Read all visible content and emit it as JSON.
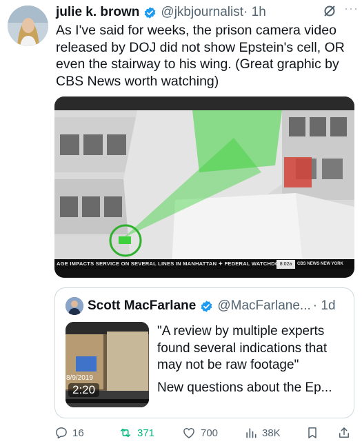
{
  "tweet": {
    "author_name": "julie k. brown",
    "handle": "@jkbjournalist",
    "time": "· 1h",
    "text": "As I've said for weeks, the prison camera video released by DOJ did not show Epstein's cell, OR even the stairway to his wing. (Great graphic by CBS News worth watching)",
    "more_label": "···",
    "icons": {
      "verified": "verified-badge-icon",
      "grok": "grok-icon",
      "more": "more-icon"
    }
  },
  "media": {
    "ticker_text": "AGE IMPACTS SERVICE ON SEVERAL LINES IN MANHATTAN ✦ FEDERAL WATCHDOG I",
    "ticker_time": "8:02a",
    "ticker_logo": "CBS NEWS NEW YORK",
    "highlight_color": "#3ed13e",
    "cell_color": "#d4433a"
  },
  "quote": {
    "author_name": "Scott MacFarlane",
    "handle": "@MacFarlane...",
    "time": "· 1d",
    "text_line1": "\"A review by multiple experts found several indications that may not be raw footage\"",
    "text_line2": "New questions about the Ep...",
    "thumb_date": "8/9/2019",
    "thumb_timer": "2:20"
  },
  "actions": {
    "replies": "16",
    "reposts": "371",
    "likes": "700",
    "views": "38K",
    "repost_color": "#00ba7c",
    "icons": [
      "reply-icon",
      "repost-icon",
      "like-icon",
      "views-icon",
      "bookmark-icon",
      "share-icon"
    ]
  }
}
